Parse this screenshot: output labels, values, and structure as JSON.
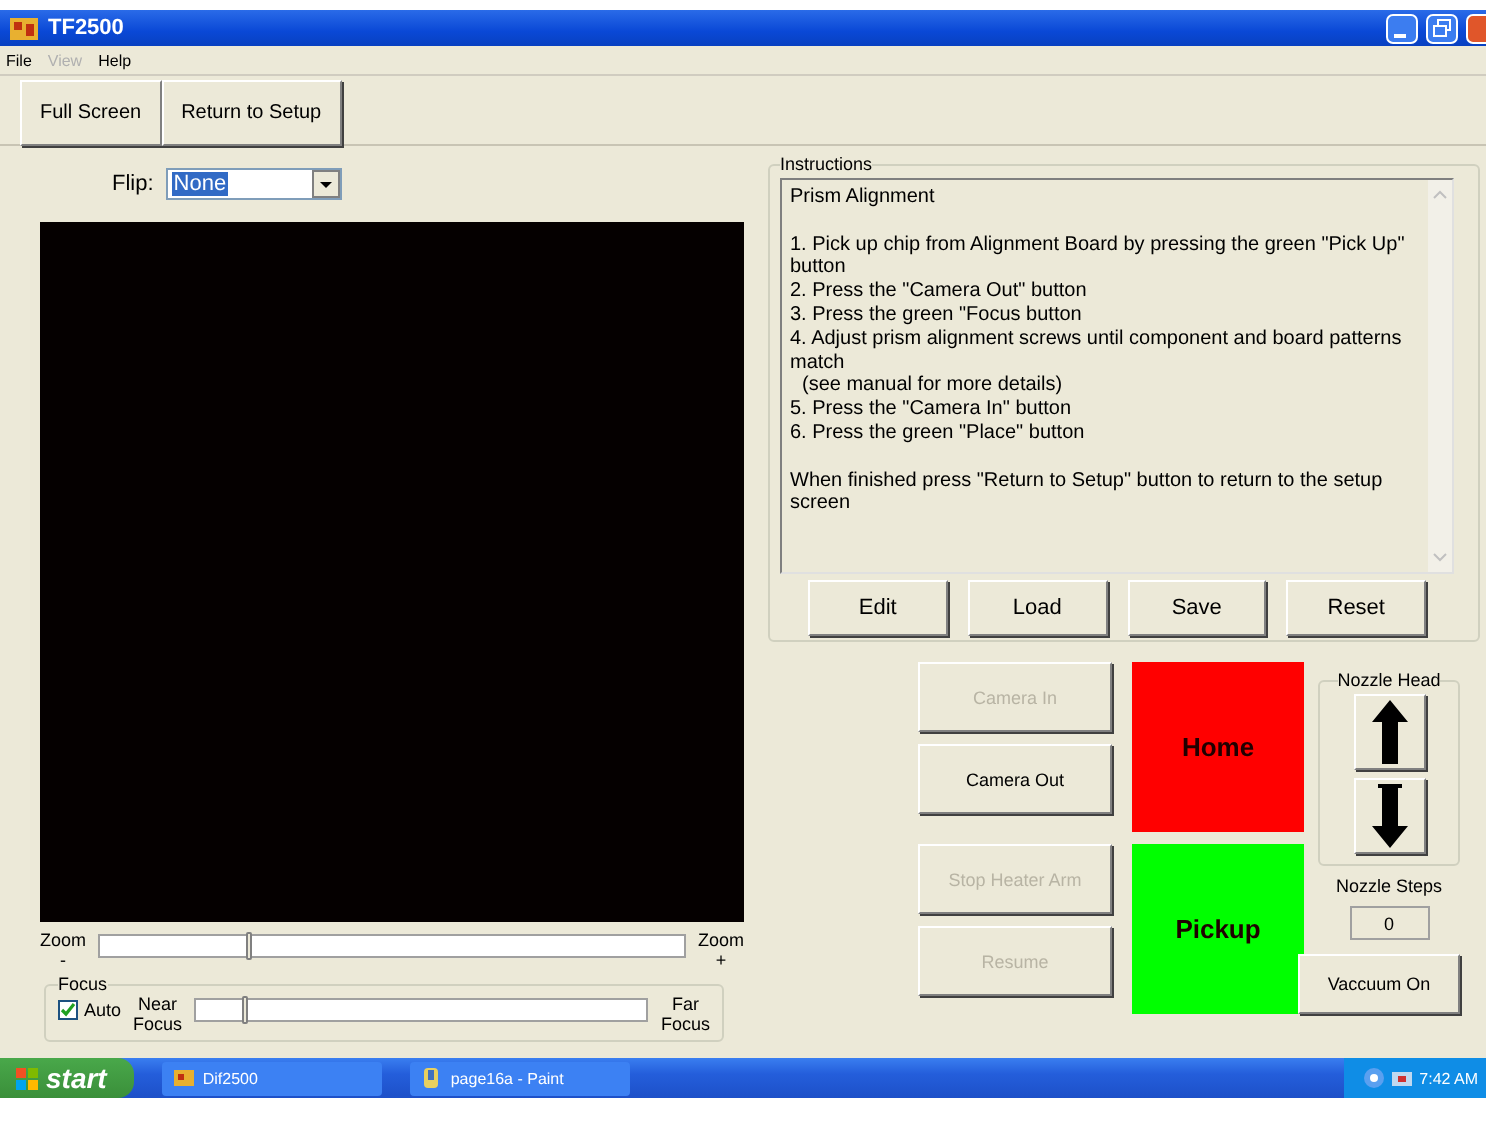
{
  "window": {
    "title": "TF2500"
  },
  "menu": [
    {
      "label": "File",
      "disabled": false
    },
    {
      "label": "View",
      "disabled": true
    },
    {
      "label": "Help",
      "disabled": false
    }
  ],
  "toolbar": [
    "Full Screen",
    "Return to Setup"
  ],
  "flip": {
    "label": "Flip:",
    "value": "None"
  },
  "zoom": {
    "min_label": "Zoom\n-",
    "max_label": "Zoom\n+",
    "level": 0.25
  },
  "focus": {
    "title": "Focus",
    "auto": {
      "label": "Auto",
      "checked": true
    },
    "min_label": "Near\nFocus",
    "max_label": "Far\nFocus",
    "level": 0.1
  },
  "instructions": {
    "title": "Instructions",
    "paragraphs": [
      [
        {
          "text": "Prism Alignment",
          "indent": false
        }
      ],
      [
        {
          "text": "1. Pick up chip from Alignment Board by pressing the green \"Pick Up\" button",
          "indent": false
        },
        {
          "text": "2. Press the \"Camera Out\" button",
          "indent": false
        },
        {
          "text": "3. Press the green \"Focus button",
          "indent": false
        },
        {
          "text": "4. Adjust prism alignment screws until component and board patterns match",
          "indent": false
        },
        {
          "text": "(see manual for more details)",
          "indent": true
        },
        {
          "text": "5. Press the \"Camera In\" button",
          "indent": false
        },
        {
          "text": "6. Press the green \"Place\" button",
          "indent": false
        }
      ],
      [
        {
          "text": "When finished press \"Return to Setup\" button to return to the setup screen",
          "indent": false
        }
      ]
    ],
    "buttons": [
      "Edit",
      "Load",
      "Save",
      "Reset"
    ]
  },
  "controls": [
    {
      "label": "Camera In",
      "disabled": true
    },
    {
      "label": "Camera Out",
      "disabled": false
    },
    {
      "label": "Stop Heater Arm",
      "disabled": true
    },
    {
      "label": "Resume",
      "disabled": true
    }
  ],
  "big_buttons": [
    {
      "label": "Home",
      "color": "#ff0000"
    },
    {
      "label": "Pickup",
      "color": "#00ff00"
    }
  ],
  "nozzle": {
    "title": "Nozzle Head",
    "steps_label": "Nozzle Steps",
    "steps": "0",
    "vacuum_button": "Vaccuum On"
  },
  "taskbar": {
    "start": "start",
    "tasks": [
      "Dif2500",
      "page16a - Paint"
    ],
    "clock": "7:42 AM"
  }
}
